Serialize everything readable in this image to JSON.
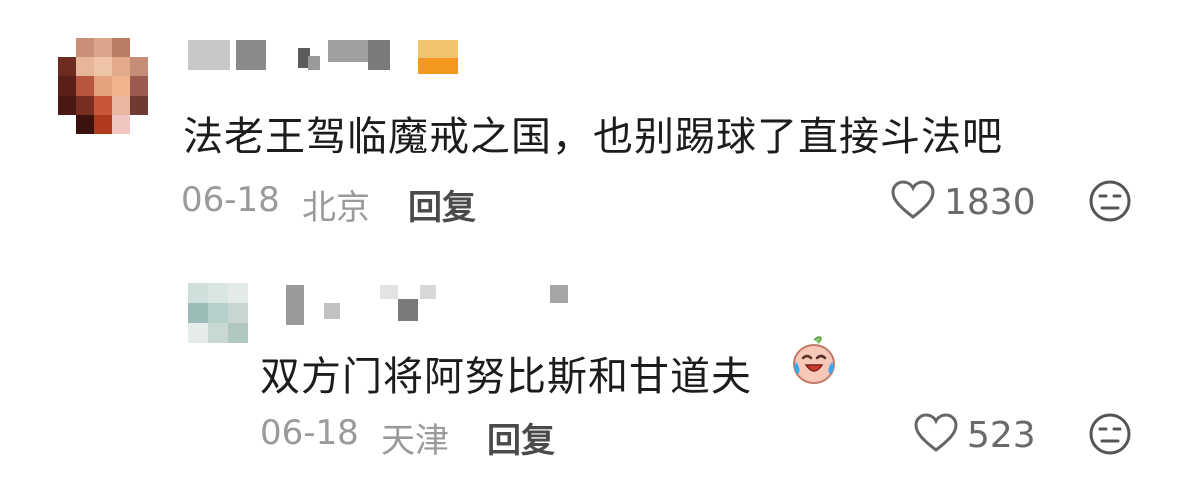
{
  "comments": [
    {
      "text": "法老王驾临魔戒之国，也别踢球了直接斗法吧",
      "date": "06-18",
      "location": "北京",
      "reply_label": "回复",
      "likes": "1830"
    }
  ],
  "replies": [
    {
      "text": "双方门将阿努比斯和甘道夫",
      "emoji": "crying-laughing-peach",
      "date": "06-18",
      "location": "天津",
      "reply_label": "回复",
      "likes": "523"
    }
  ],
  "icons": {
    "like": "heart-outline-icon",
    "dislike": "unamused-face-icon"
  },
  "colors": {
    "meta": "#9a9a9a",
    "text": "#1c1c1c",
    "reply": "#4a4a4a"
  }
}
